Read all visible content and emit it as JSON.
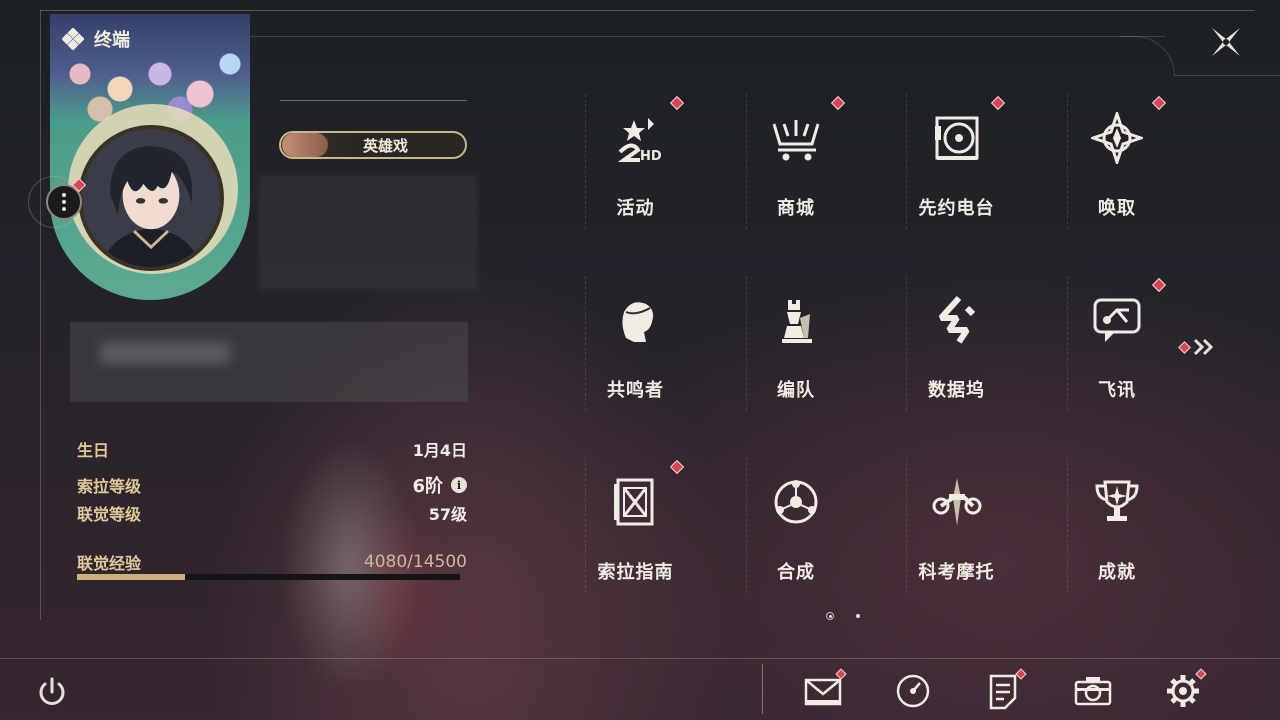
{
  "header": {
    "title": "终端"
  },
  "profile": {
    "title_badge": "英雄戏",
    "stats": [
      {
        "key": "生日",
        "value": "1月4日"
      },
      {
        "key": "索拉等级",
        "value": "6阶"
      },
      {
        "key": "联觉等级",
        "value": "57级"
      }
    ],
    "exp": {
      "label": "联觉经验",
      "value": "4080/14500",
      "progress": 0.281
    }
  },
  "menu": [
    {
      "label": "活动",
      "icon": "event-2nd-icon",
      "badge": true
    },
    {
      "label": "商城",
      "icon": "shop-cart-icon",
      "badge": true
    },
    {
      "label": "先约电台",
      "icon": "radio-vinyl-icon",
      "badge": true
    },
    {
      "label": "唤取",
      "icon": "convene-compass-icon",
      "badge": true
    },
    {
      "label": "共鸣者",
      "icon": "resonator-head-icon",
      "badge": false
    },
    {
      "label": "编队",
      "icon": "team-chess-icon",
      "badge": false
    },
    {
      "label": "数据坞",
      "icon": "data-bank-icon",
      "badge": false
    },
    {
      "label": "飞讯",
      "icon": "message-chat-icon",
      "badge": true
    },
    {
      "label": "索拉指南",
      "icon": "guidebook-icon",
      "badge": true
    },
    {
      "label": "合成",
      "icon": "synthesis-icon",
      "badge": false
    },
    {
      "label": "科考摩托",
      "icon": "motorcycle-icon",
      "badge": false
    },
    {
      "label": "成就",
      "icon": "trophy-icon",
      "badge": false
    }
  ],
  "bottom_bar": [
    {
      "name": "mail",
      "icon": "mail-icon",
      "badge": true
    },
    {
      "name": "clock",
      "icon": "clock-icon",
      "badge": false
    },
    {
      "name": "notes",
      "icon": "notes-icon",
      "badge": true
    },
    {
      "name": "camera",
      "icon": "camera-icon",
      "badge": false
    },
    {
      "name": "settings",
      "icon": "gear-icon",
      "badge": true
    }
  ],
  "colors": {
    "accent_gold": "#cfae7a",
    "badge_red": "#d64554",
    "label_gold": "#e0c99a"
  }
}
